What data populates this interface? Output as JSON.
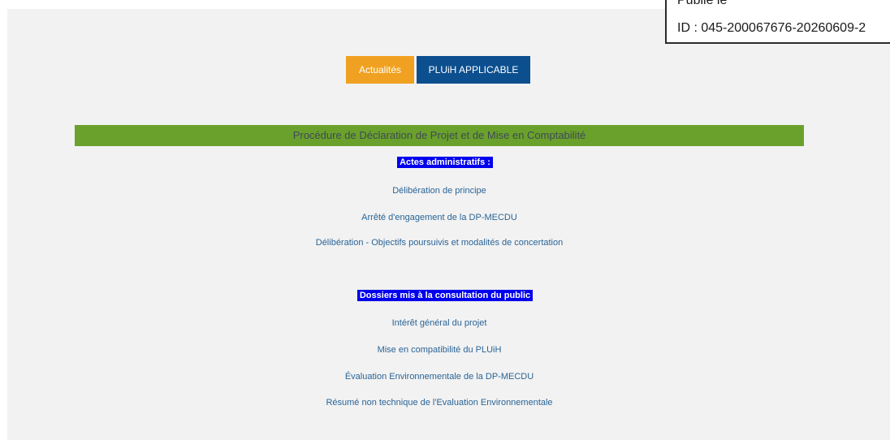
{
  "stamp": {
    "line1": "Publié le",
    "line2": "ID : 045-200067676-20260609-2"
  },
  "nav": {
    "actualites_label": "Actualités",
    "pluih_label": "PLUiH APPLICABLE"
  },
  "section": {
    "title": "Procédure de Déclaration de Projet et de Mise en Comptabilité"
  },
  "actes": {
    "heading": "Actes administratifs :",
    "links": [
      "Délibération de principe",
      "Arrêté d'engagement de la DP-MECDU",
      "Délibération - Objectifs poursuivis et modalités de concertation"
    ]
  },
  "dossiers": {
    "heading": "Dossiers mis à la consultation du public",
    "links": [
      "Intérêt général du projet",
      "Mise en compatibilité du PLUiH",
      "Évaluation Environnementale de la DP-MECDU",
      "Résumé non technique de l'Evaluation Environnementale"
    ]
  },
  "colors": {
    "accent_orange": "#f0a122",
    "accent_blue": "#0c4f8f",
    "section_green": "#6aa12c",
    "heading_highlight": "#0000ee",
    "link_blue": "#2a6496"
  }
}
